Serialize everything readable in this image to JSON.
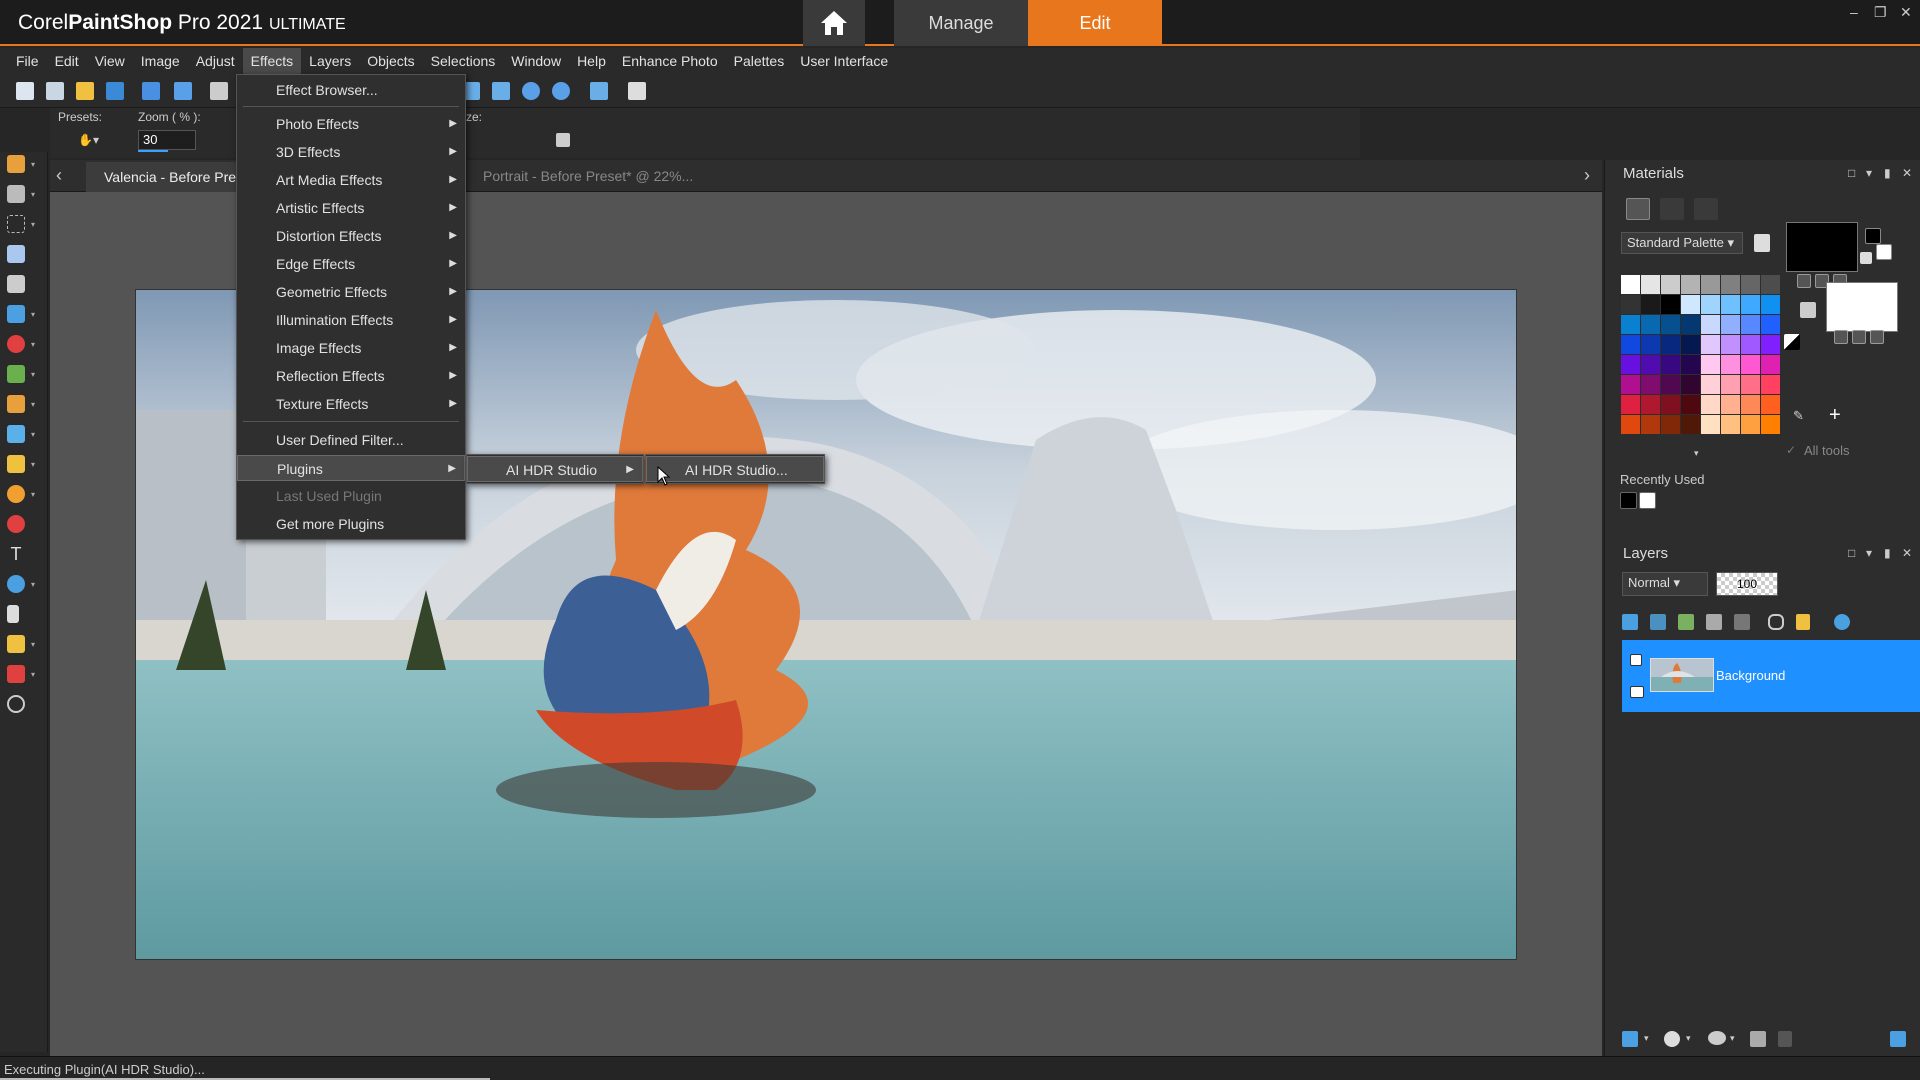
{
  "titlebar": {
    "brand_corel": "Corel",
    "brand_psp": "PaintShop",
    "brand_pro": " Pro 2021 ",
    "brand_edition": "ULTIMATE",
    "tab_manage": "Manage",
    "tab_edit": "Edit",
    "win_minimize": "–",
    "win_restore": "❐",
    "win_close": "✕"
  },
  "menubar": {
    "items": [
      "File",
      "Edit",
      "View",
      "Image",
      "Adjust",
      "Effects",
      "Layers",
      "Objects",
      "Selections",
      "Window",
      "Help",
      "Enhance Photo",
      "Palettes",
      "User Interface"
    ]
  },
  "options": {
    "presets_label": "Presets:",
    "zoom_label": "Zoom ( % ):",
    "zoom_value": "30",
    "size_label_fragment": "ze:"
  },
  "documents": {
    "tab1": "Valencia - Before Preset",
    "tab2": "Portrait - Before Preset* @  22%...",
    "prev": "‹",
    "next": "›"
  },
  "effects_menu": {
    "items": [
      {
        "label": "Effect Browser...",
        "arrow": ""
      },
      {
        "label": "Photo Effects",
        "arrow": "▶"
      },
      {
        "label": "3D Effects",
        "arrow": "▶"
      },
      {
        "label": "Art Media Effects",
        "arrow": "▶"
      },
      {
        "label": "Artistic Effects",
        "arrow": "▶"
      },
      {
        "label": "Distortion Effects",
        "arrow": "▶"
      },
      {
        "label": "Edge Effects",
        "arrow": "▶"
      },
      {
        "label": "Geometric Effects",
        "arrow": "▶"
      },
      {
        "label": "Illumination Effects",
        "arrow": "▶"
      },
      {
        "label": "Image Effects",
        "arrow": "▶"
      },
      {
        "label": "Reflection Effects",
        "arrow": "▶"
      },
      {
        "label": "Texture Effects",
        "arrow": "▶"
      },
      {
        "label": "User Defined Filter...",
        "arrow": ""
      },
      {
        "label": "Plugins",
        "arrow": "▶"
      },
      {
        "label": "Last Used Plugin",
        "arrow": ""
      },
      {
        "label": "Get more Plugins",
        "arrow": ""
      }
    ]
  },
  "plugins_submenu": {
    "item": "AI HDR Studio",
    "arrow": "▶"
  },
  "plugin_submenu2": {
    "item": "AI HDR Studio..."
  },
  "materials": {
    "title": "Materials",
    "palette_select": "Standard Palette",
    "all_tools": "All tools",
    "recently_used": "Recently Used",
    "add": "+"
  },
  "layers": {
    "title": "Layers",
    "blend_mode": "Normal",
    "opacity": "100",
    "layer_name": "Background"
  },
  "status": {
    "text": "Executing Plugin(AI HDR Studio)..."
  },
  "colors": {
    "accent": "#e8761c",
    "selection": "#1e90ff"
  }
}
